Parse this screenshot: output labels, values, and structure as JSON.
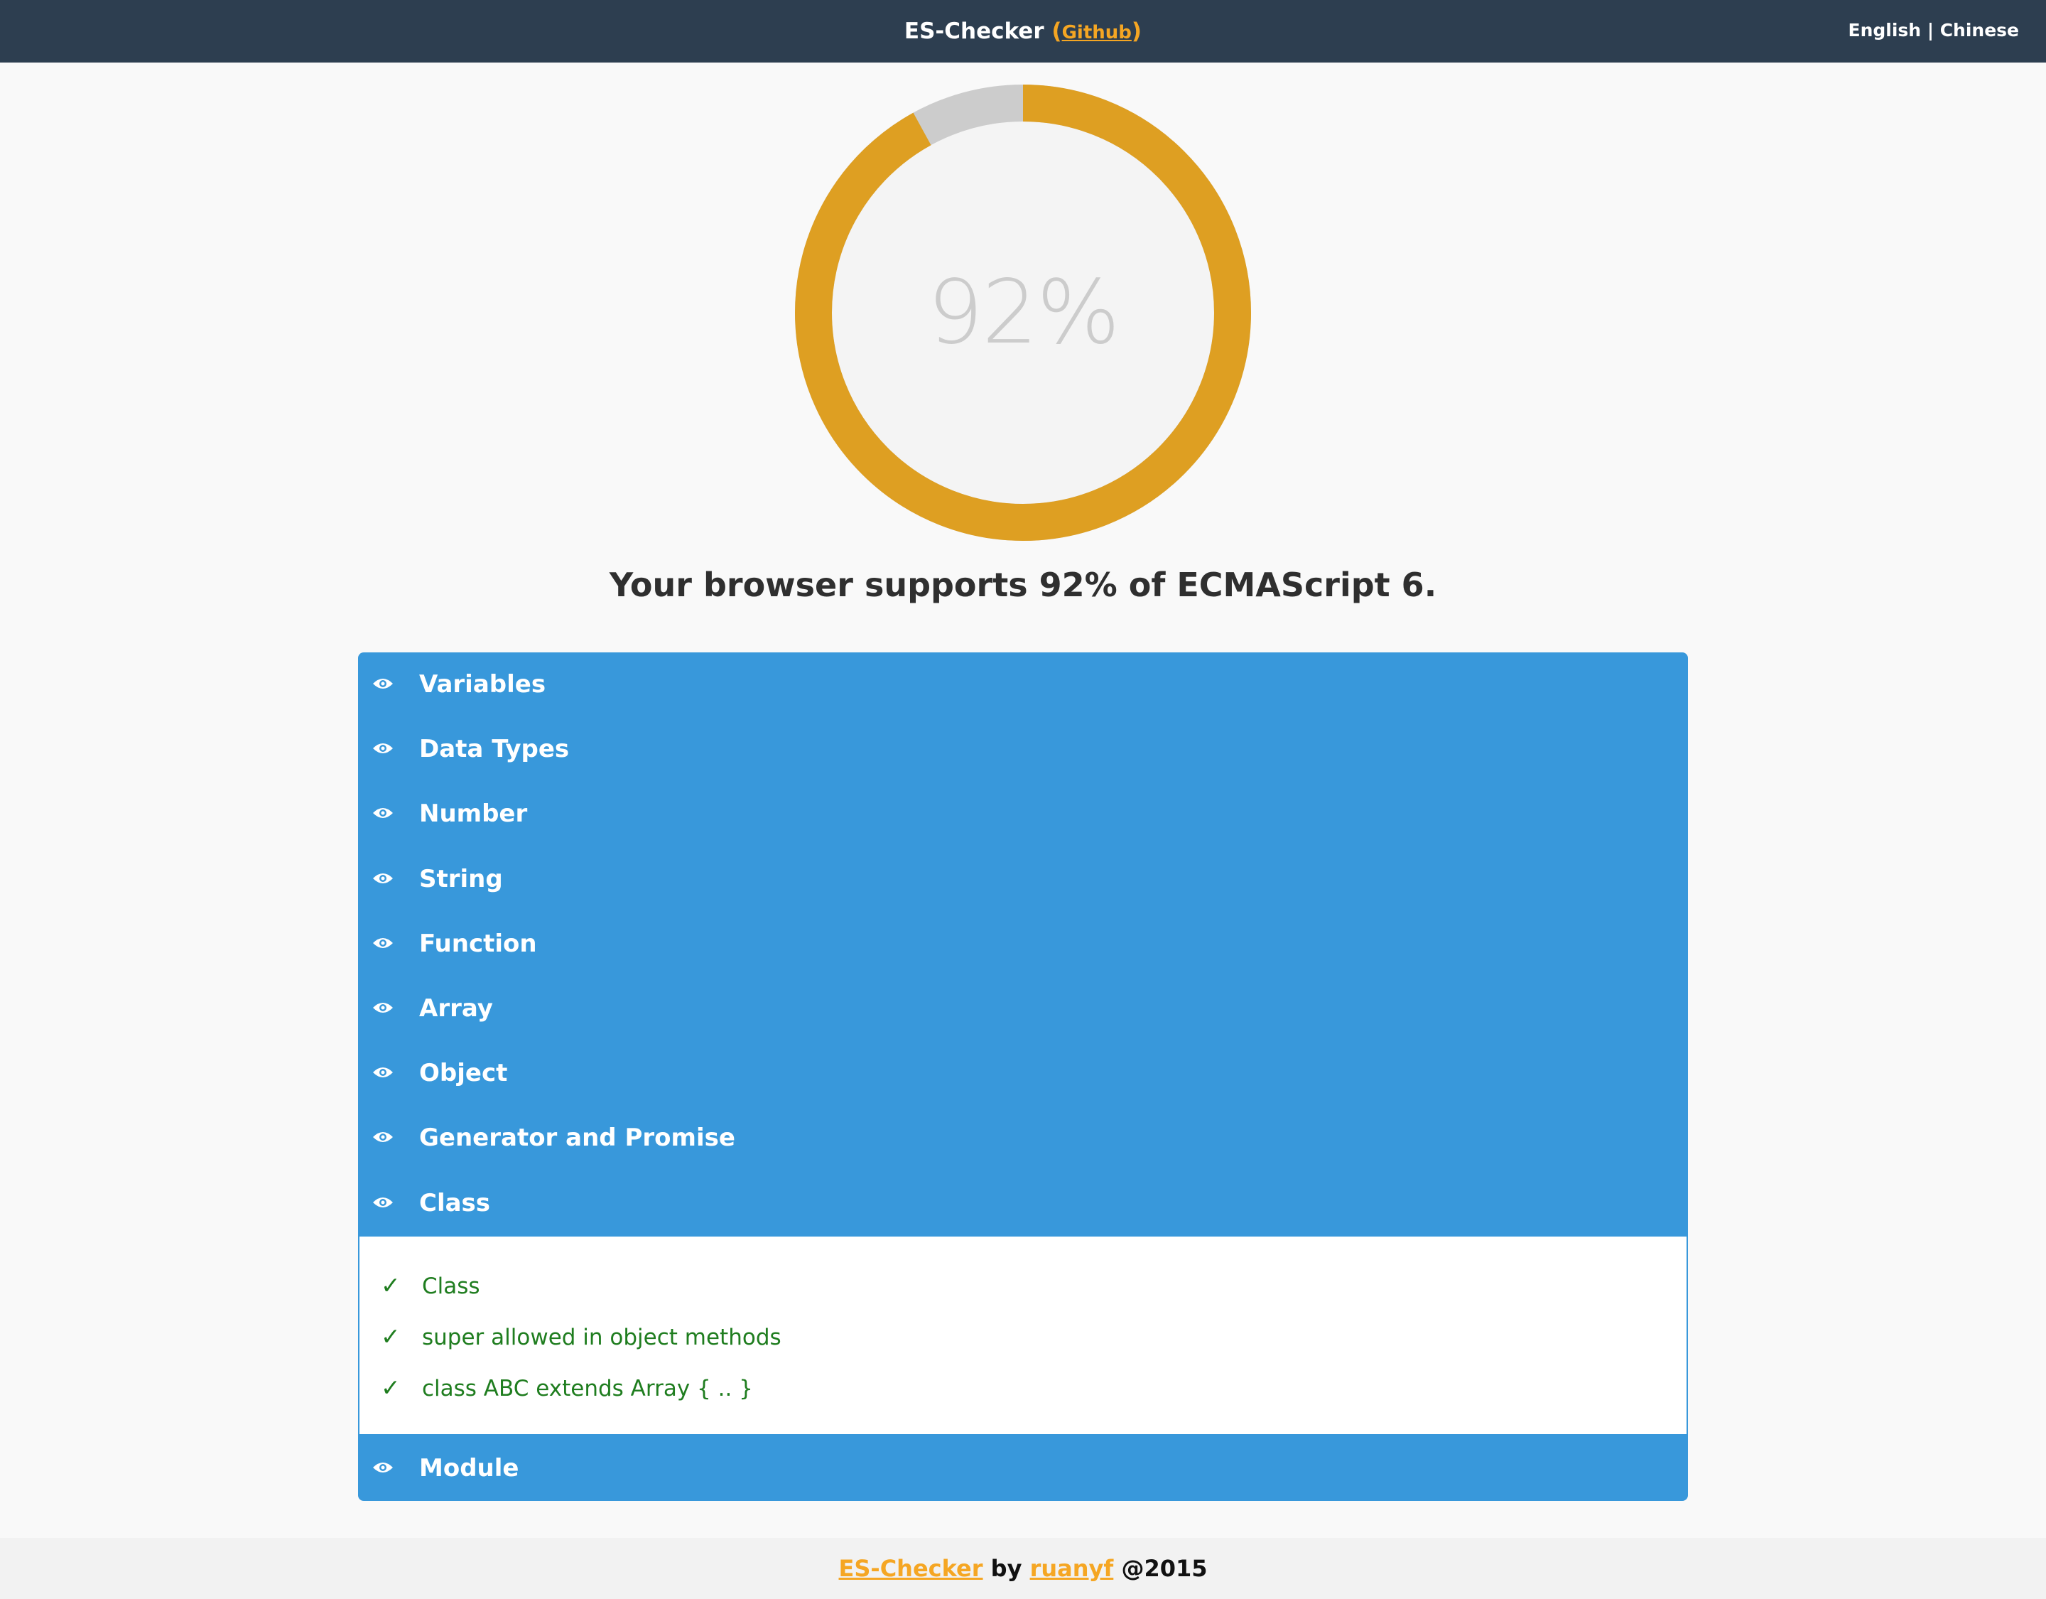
{
  "header": {
    "title": "ES-Checker",
    "paren_open": "(",
    "github_link": "Github",
    "paren_close": ")",
    "lang_english": "English",
    "lang_separator": "|",
    "lang_chinese": "Chinese"
  },
  "progress": {
    "value": 92,
    "label": "92%",
    "fill_color": "#de9f22",
    "remaining_color": "#cccccc"
  },
  "summary": "Your browser supports 92% of ECMAScript 6.",
  "sections": [
    {
      "label": "Variables"
    },
    {
      "label": "Data Types"
    },
    {
      "label": "Number"
    },
    {
      "label": "String"
    },
    {
      "label": "Function"
    },
    {
      "label": "Array"
    },
    {
      "label": "Object"
    },
    {
      "label": "Generator and Promise"
    },
    {
      "label": "Class",
      "expanded": true
    },
    {
      "label": "Module"
    }
  ],
  "class_items": [
    {
      "status": "✓",
      "label": "Class"
    },
    {
      "status": "✓",
      "label": "super allowed in object methods"
    },
    {
      "status": "✓",
      "label": "class ABC extends Array { .. }"
    }
  ],
  "footer": {
    "link1": "ES-Checker",
    "by": "by",
    "link2": "ruanyf",
    "year": "@2015"
  },
  "colors": {
    "header_bg": "#2d3e50",
    "accent": "#f5a623",
    "section_bg": "#3898db",
    "pass_green": "#1f7d1f"
  }
}
